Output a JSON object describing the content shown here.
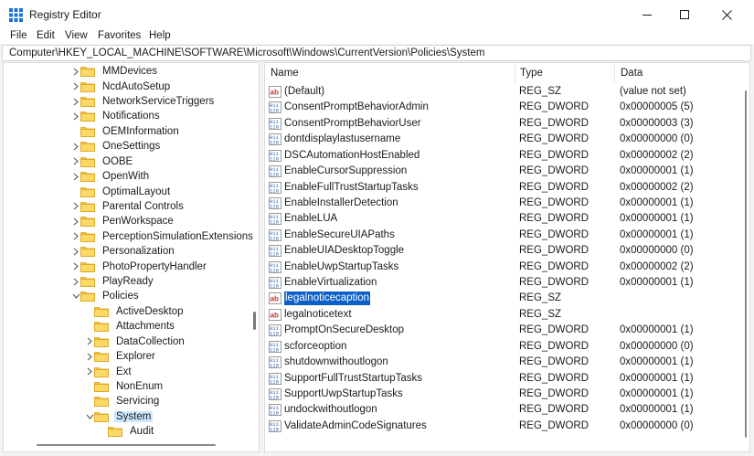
{
  "window": {
    "title": "Registry Editor",
    "minimize_glyph": "—",
    "maximize_glyph": "☐",
    "close_glyph": "✕"
  },
  "menu": [
    "File",
    "Edit",
    "View",
    "Favorites",
    "Help"
  ],
  "address": "Computer\\HKEY_LOCAL_MACHINE\\SOFTWARE\\Microsoft\\Windows\\CurrentVersion\\Policies\\System",
  "tree": [
    {
      "label": "MMDevices",
      "level": 0,
      "state": "collapsed"
    },
    {
      "label": "NcdAutoSetup",
      "level": 0,
      "state": "collapsed"
    },
    {
      "label": "NetworkServiceTriggers",
      "level": 0,
      "state": "collapsed"
    },
    {
      "label": "Notifications",
      "level": 0,
      "state": "collapsed"
    },
    {
      "label": "OEMInformation",
      "level": 0,
      "state": "none"
    },
    {
      "label": "OneSettings",
      "level": 0,
      "state": "collapsed"
    },
    {
      "label": "OOBE",
      "level": 0,
      "state": "collapsed"
    },
    {
      "label": "OpenWith",
      "level": 0,
      "state": "collapsed"
    },
    {
      "label": "OptimalLayout",
      "level": 0,
      "state": "none"
    },
    {
      "label": "Parental Controls",
      "level": 0,
      "state": "collapsed"
    },
    {
      "label": "PenWorkspace",
      "level": 0,
      "state": "collapsed"
    },
    {
      "label": "PerceptionSimulationExtensions",
      "level": 0,
      "state": "collapsed"
    },
    {
      "label": "Personalization",
      "level": 0,
      "state": "collapsed"
    },
    {
      "label": "PhotoPropertyHandler",
      "level": 0,
      "state": "collapsed"
    },
    {
      "label": "PlayReady",
      "level": 0,
      "state": "collapsed"
    },
    {
      "label": "Policies",
      "level": 0,
      "state": "expanded"
    },
    {
      "label": "ActiveDesktop",
      "level": 1,
      "state": "none"
    },
    {
      "label": "Attachments",
      "level": 1,
      "state": "none"
    },
    {
      "label": "DataCollection",
      "level": 1,
      "state": "collapsed"
    },
    {
      "label": "Explorer",
      "level": 1,
      "state": "collapsed"
    },
    {
      "label": "Ext",
      "level": 1,
      "state": "collapsed"
    },
    {
      "label": "NonEnum",
      "level": 1,
      "state": "none"
    },
    {
      "label": "Servicing",
      "level": 1,
      "state": "none"
    },
    {
      "label": "System",
      "level": 1,
      "state": "expanded",
      "selected": true
    },
    {
      "label": "Audit",
      "level": 2,
      "state": "none"
    }
  ],
  "columns": {
    "name": "Name",
    "type": "Type",
    "data": "Data"
  },
  "values": [
    {
      "name": "(Default)",
      "type": "REG_SZ",
      "data": "(value not set)",
      "icon": "string-value-icon"
    },
    {
      "name": "ConsentPromptBehaviorAdmin",
      "type": "REG_DWORD",
      "data": "0x00000005 (5)",
      "icon": "binary-value-icon"
    },
    {
      "name": "ConsentPromptBehaviorUser",
      "type": "REG_DWORD",
      "data": "0x00000003 (3)",
      "icon": "binary-value-icon"
    },
    {
      "name": "dontdisplaylastusername",
      "type": "REG_DWORD",
      "data": "0x00000000 (0)",
      "icon": "binary-value-icon"
    },
    {
      "name": "DSCAutomationHostEnabled",
      "type": "REG_DWORD",
      "data": "0x00000002 (2)",
      "icon": "binary-value-icon"
    },
    {
      "name": "EnableCursorSuppression",
      "type": "REG_DWORD",
      "data": "0x00000001 (1)",
      "icon": "binary-value-icon"
    },
    {
      "name": "EnableFullTrustStartupTasks",
      "type": "REG_DWORD",
      "data": "0x00000002 (2)",
      "icon": "binary-value-icon"
    },
    {
      "name": "EnableInstallerDetection",
      "type": "REG_DWORD",
      "data": "0x00000001 (1)",
      "icon": "binary-value-icon"
    },
    {
      "name": "EnableLUA",
      "type": "REG_DWORD",
      "data": "0x00000001 (1)",
      "icon": "binary-value-icon"
    },
    {
      "name": "EnableSecureUIAPaths",
      "type": "REG_DWORD",
      "data": "0x00000001 (1)",
      "icon": "binary-value-icon"
    },
    {
      "name": "EnableUIADesktopToggle",
      "type": "REG_DWORD",
      "data": "0x00000000 (0)",
      "icon": "binary-value-icon"
    },
    {
      "name": "EnableUwpStartupTasks",
      "type": "REG_DWORD",
      "data": "0x00000002 (2)",
      "icon": "binary-value-icon"
    },
    {
      "name": "EnableVirtualization",
      "type": "REG_DWORD",
      "data": "0x00000001 (1)",
      "icon": "binary-value-icon"
    },
    {
      "name": "legalnoticecaption",
      "type": "REG_SZ",
      "data": "",
      "icon": "string-value-icon",
      "selected": true
    },
    {
      "name": "legalnoticetext",
      "type": "REG_SZ",
      "data": "",
      "icon": "string-value-icon"
    },
    {
      "name": "PromptOnSecureDesktop",
      "type": "REG_DWORD",
      "data": "0x00000001 (1)",
      "icon": "binary-value-icon"
    },
    {
      "name": "scforceoption",
      "type": "REG_DWORD",
      "data": "0x00000000 (0)",
      "icon": "binary-value-icon"
    },
    {
      "name": "shutdownwithoutlogon",
      "type": "REG_DWORD",
      "data": "0x00000001 (1)",
      "icon": "binary-value-icon"
    },
    {
      "name": "SupportFullTrustStartupTasks",
      "type": "REG_DWORD",
      "data": "0x00000001 (1)",
      "icon": "binary-value-icon"
    },
    {
      "name": "SupportUwpStartupTasks",
      "type": "REG_DWORD",
      "data": "0x00000001 (1)",
      "icon": "binary-value-icon"
    },
    {
      "name": "undockwithoutlogon",
      "type": "REG_DWORD",
      "data": "0x00000001 (1)",
      "icon": "binary-value-icon"
    },
    {
      "name": "ValidateAdminCodeSignatures",
      "type": "REG_DWORD",
      "data": "0x00000000 (0)",
      "icon": "binary-value-icon"
    }
  ],
  "colors": {
    "selection": "#0a5fc8",
    "folder": "#f4c542",
    "tree_selection": "#cce8ff"
  }
}
